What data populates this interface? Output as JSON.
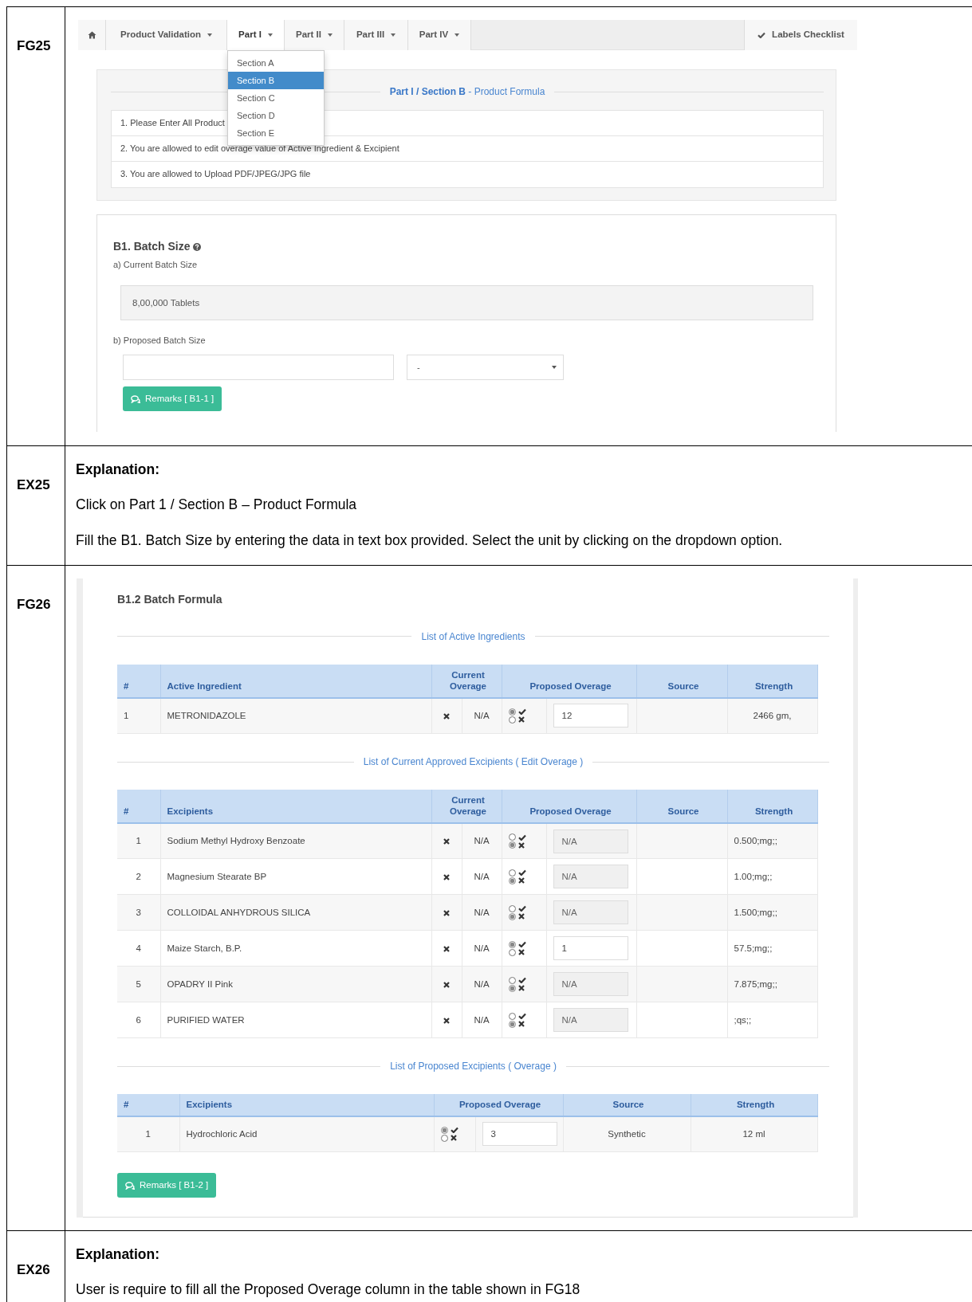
{
  "fg25": {
    "label": "FG25",
    "tabs": [
      {
        "kind": "home",
        "selected": false
      },
      {
        "kind": "menu",
        "label": "Product Validation",
        "selected": false
      },
      {
        "kind": "menu",
        "label": "Part I",
        "selected": true
      },
      {
        "kind": "menu",
        "label": "Part II",
        "selected": false
      },
      {
        "kind": "menu",
        "label": "Part III",
        "selected": false
      },
      {
        "kind": "menu",
        "label": "Part IV",
        "selected": false
      }
    ],
    "checklist": "Labels Checklist",
    "dropdown": [
      {
        "label": "Section A",
        "selected": false
      },
      {
        "label": "Section B",
        "selected": true
      },
      {
        "label": "Section C",
        "selected": false
      },
      {
        "label": "Section D",
        "selected": false
      },
      {
        "label": "Section E",
        "selected": false
      }
    ],
    "panel_title": "**Part I / Section B** - Product Formula",
    "notes": [
      "1. Please Enter All Product",
      "2. You are allowed to edit overage value of Active Ingredient & Excipient",
      "3. You are allowed to Upload PDF/JPEG/JPG file"
    ],
    "batch": {
      "title": "B1. Batch Size",
      "current_label": "a) Current Batch Size",
      "current_value": "8,00,000 Tablets",
      "proposed_label": "b) Proposed Batch Size",
      "unit": "-",
      "remarks": "Remarks [ B1-1 ]"
    }
  },
  "ex25": {
    "label": "EX25",
    "heading": "Explanation:",
    "lines": [
      "Click on Part 1 / Section B – Product Formula",
      "Fill the B1. Batch Size by entering the data in text box provided. Select the unit by clicking on the dropdown option."
    ]
  },
  "fg26": {
    "label": "FG26",
    "title": "B1.2 Batch Formula",
    "tables": [
      {
        "kind": "current",
        "heading": "List of Active Ingredients",
        "columns": [
          "#",
          "Active Ingredient",
          "Current Overage",
          "Proposed Overage",
          "Source",
          "Strength"
        ],
        "rows": [
          {
            "no": "1",
            "name": "METRONIDAZOLE",
            "current": "N/A",
            "accept": true,
            "proposed": "12",
            "strength": "2466 gm,"
          }
        ]
      },
      {
        "kind": "current",
        "heading": "List of Current Approved Excipients ( Edit Overage )",
        "columns": [
          "#",
          "Excipients",
          "Current Overage",
          "Proposed Overage",
          "Source",
          "Strength"
        ],
        "rows": [
          {
            "no": "1",
            "name": "Sodium Methyl Hydroxy Benzoate",
            "current": "N/A",
            "accept": false,
            "proposed": "N/A",
            "strength": "0.500;mg;;"
          },
          {
            "no": "2",
            "name": "Magnesium Stearate BP",
            "current": "N/A",
            "accept": false,
            "proposed": "N/A",
            "strength": "1.00;mg;;"
          },
          {
            "no": "3",
            "name": "COLLOIDAL ANHYDROUS SILICA",
            "current": "N/A",
            "accept": false,
            "proposed": "N/A",
            "strength": "1.500;mg;;"
          },
          {
            "no": "4",
            "name": "Maize Starch, B.P.",
            "current": "N/A",
            "accept": true,
            "proposed": "1",
            "strength": "57.5;mg;;"
          },
          {
            "no": "5",
            "name": "OPADRY II Pink",
            "current": "N/A",
            "accept": false,
            "proposed": "N/A",
            "strength": "7.875;mg;;"
          },
          {
            "no": "6",
            "name": "PURIFIED WATER",
            "current": "N/A",
            "accept": false,
            "proposed": "N/A",
            "strength": ";qs;;"
          }
        ]
      },
      {
        "kind": "proposed",
        "heading": "List of Proposed Excipients ( Overage )",
        "columns": [
          "#",
          "Excipients",
          "Proposed Overage",
          "Source",
          "Strength"
        ],
        "rows": [
          {
            "no": "1",
            "name": "Hydrochloric Acid",
            "accept": true,
            "proposed": "3",
            "source": "Synthetic",
            "strength": "12 ml"
          }
        ]
      }
    ],
    "remarks": "Remarks [ B1-2 ]"
  },
  "ex26": {
    "label": "EX26",
    "heading": "Explanation:",
    "lines": [
      "User is require to fill all the Proposed Overage column in the table shown in FG18"
    ]
  }
}
